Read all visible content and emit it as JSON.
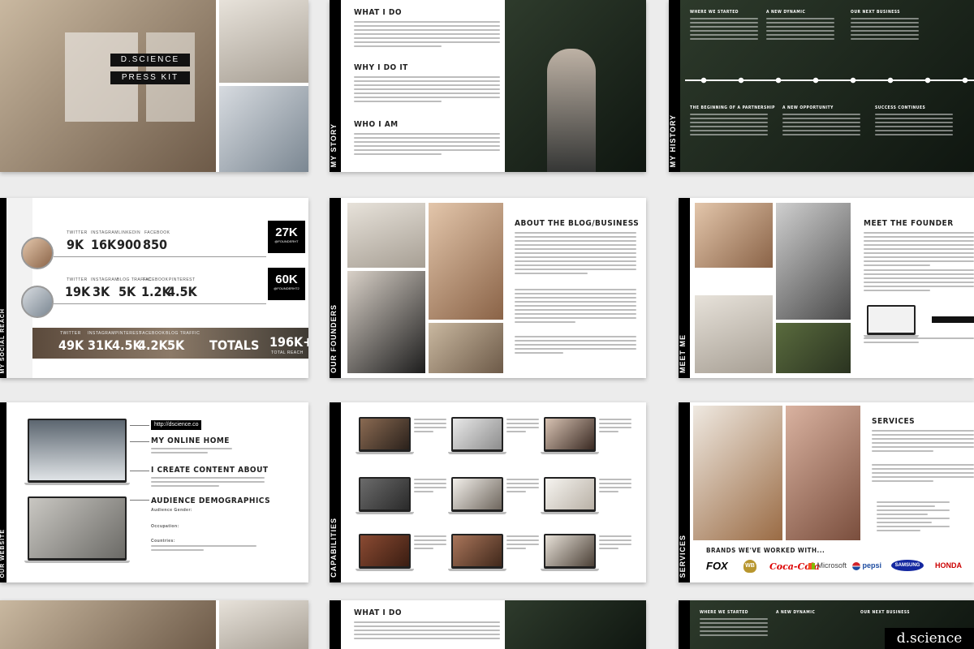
{
  "slides": {
    "cover": {
      "title": "D.SCIENCE",
      "subtitle": "PRESS KIT"
    },
    "story": {
      "vertical_label": "MY STORY",
      "headings": [
        "WHAT I DO",
        "WHY I DO IT",
        "WHO I AM"
      ]
    },
    "history": {
      "vertical_label": "MY HISTORY",
      "top_headings": [
        "WHERE WE STARTED",
        "A NEW DYNAMIC",
        "OUR NEXT BUSINESS"
      ],
      "bottom_headings": [
        "THE BEGINNING OF A PARTNERSHIP",
        "A NEW OPPORTUNITY",
        "SUCCESS CONTINUES"
      ]
    },
    "reach": {
      "vertical_label": "MY SOCIAL REACH",
      "row1": {
        "labels": [
          "TWITTER",
          "INSTAGRAM",
          "LINKEDIN",
          "FACEBOOK"
        ],
        "values": [
          "9K",
          "16K",
          "900",
          "850"
        ],
        "total": "27K",
        "handle": "@FOUNDERHT"
      },
      "row2": {
        "labels": [
          "TWITTER",
          "INSTAGRAM",
          "BLOG TRAFFIC",
          "FACEBOOK",
          "PINTEREST"
        ],
        "values": [
          "19K",
          "3K",
          "5K",
          "1.2K",
          "4.5K"
        ],
        "total": "60K",
        "handle": "@FOUNDERHT2"
      },
      "totals_row": {
        "labels": [
          "TWITTER",
          "INSTAGRAM",
          "PINTEREST",
          "FACEBOOK",
          "BLOG TRAFFIC"
        ],
        "values": [
          "49K",
          "31K",
          "4.5K",
          "4.2K",
          "5K"
        ],
        "totals_label": "TOTALS",
        "grand_total": "196K+",
        "grand_caption": "TOTAL REACH"
      }
    },
    "founders": {
      "vertical_label": "OUR FOUNDERS",
      "heading": "ABOUT THE BLOG/BUSINESS"
    },
    "meet": {
      "vertical_label": "MEET ME",
      "heading": "MEET THE FOUNDER"
    },
    "website": {
      "vertical_label": "OUR WEBSITE",
      "url": "http://dscience.co",
      "headings": [
        "MY ONLINE HOME",
        "I CREATE CONTENT ABOUT",
        "AUDIENCE DEMOGRAPHICS"
      ],
      "fields": [
        "Audience Gender:",
        "Occupation:",
        "Countries:"
      ]
    },
    "capabilities": {
      "vertical_label": "CAPABILITIES"
    },
    "services": {
      "vertical_label": "SERVICES",
      "heading": "SERVICES",
      "brands_heading": "BRANDS WE'VE WORKED WITH...",
      "brands": [
        "FOX",
        "WB",
        "Coca-Cola",
        "Microsoft",
        "pepsi",
        "SAMSUNG",
        "HONDA"
      ]
    }
  },
  "watermark": "d.science",
  "colors": {
    "accent": "#000000",
    "background": "#ececec",
    "foliage": "#1d2b1c"
  }
}
